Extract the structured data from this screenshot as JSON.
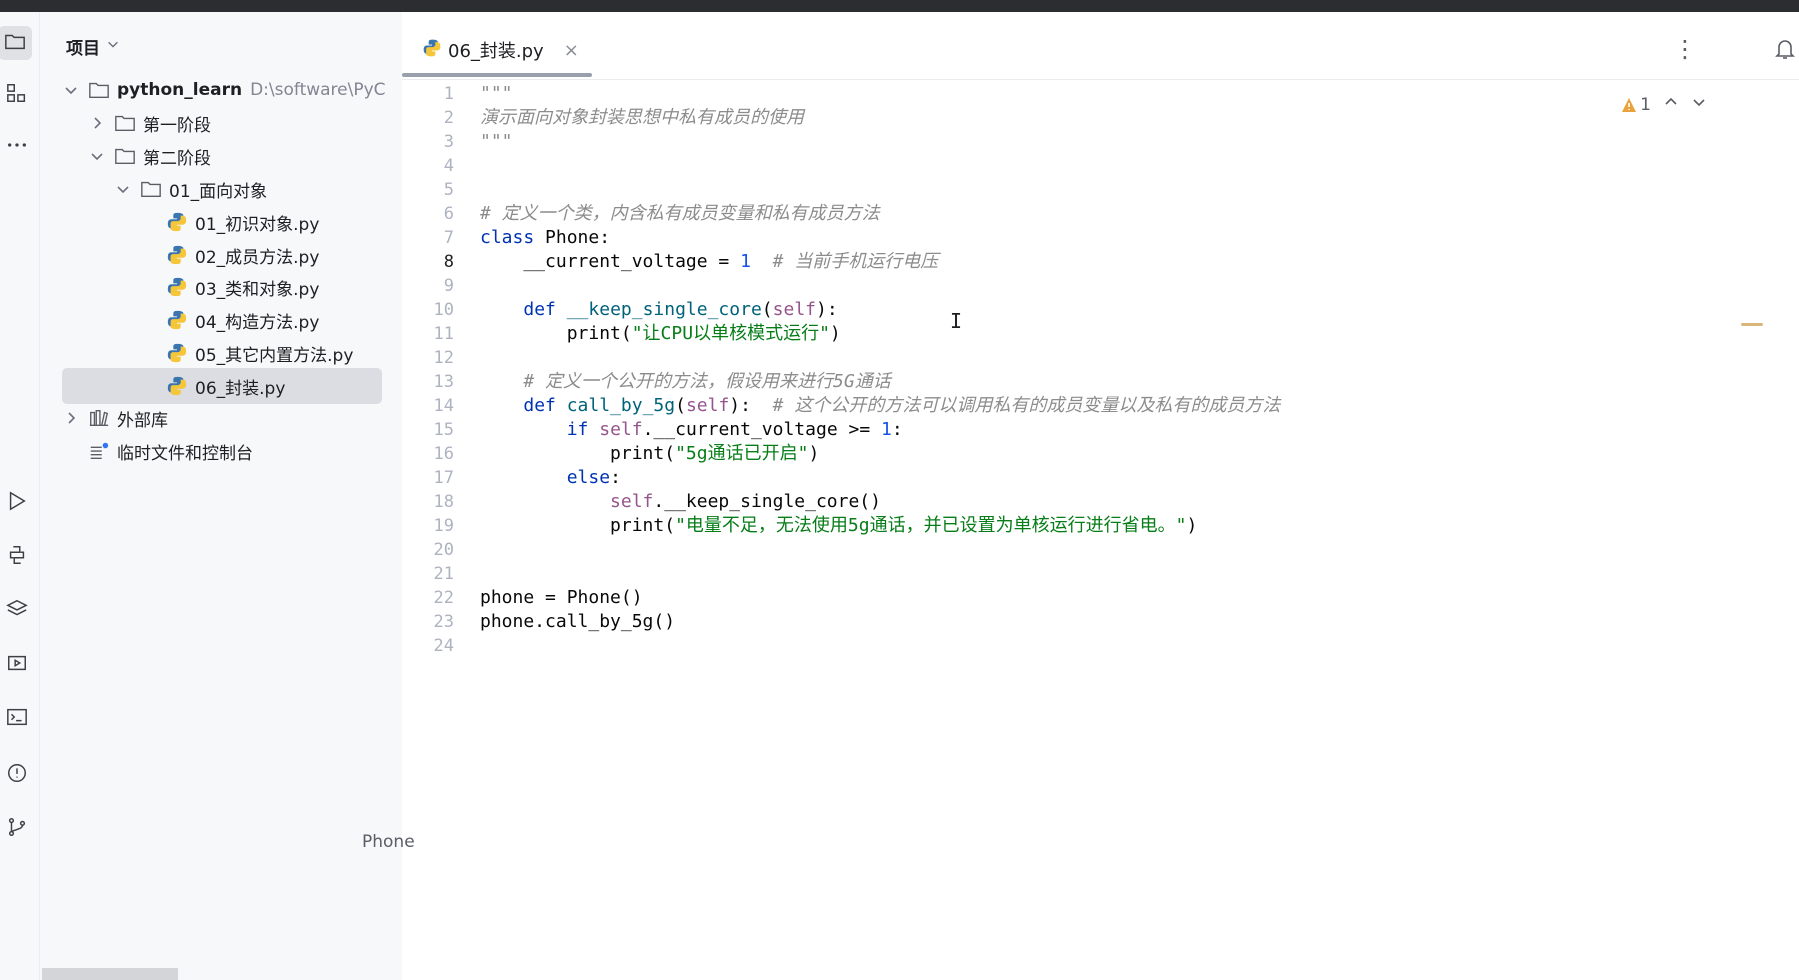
{
  "sidebar": {
    "header": {
      "title": "项目"
    },
    "tree": [
      {
        "label": "python_learn",
        "hint": "D:\\software\\PyC",
        "level": 0,
        "expanded": true,
        "type": "folder"
      },
      {
        "label": "第一阶段",
        "level": 1,
        "expanded": false,
        "type": "folder"
      },
      {
        "label": "第二阶段",
        "level": 1,
        "expanded": true,
        "type": "folder"
      },
      {
        "label": "01_面向对象",
        "level": 2,
        "expanded": true,
        "type": "folder"
      },
      {
        "label": "01_初识对象.py",
        "level": 3,
        "type": "python-file"
      },
      {
        "label": "02_成员方法.py",
        "level": 3,
        "type": "python-file"
      },
      {
        "label": "03_类和对象.py",
        "level": 3,
        "type": "python-file"
      },
      {
        "label": "04_构造方法.py",
        "level": 3,
        "type": "python-file"
      },
      {
        "label": "05_其它内置方法.py",
        "level": 3,
        "type": "python-file"
      },
      {
        "label": "06_封装.py",
        "level": 3,
        "type": "python-file",
        "selected": true
      },
      {
        "label": "外部库",
        "level": 0,
        "expanded": false,
        "type": "library"
      },
      {
        "label": "临时文件和控制台",
        "level": 0,
        "type": "scratches"
      }
    ]
  },
  "editor": {
    "tab": {
      "label": "06_封装.py",
      "close": "×"
    },
    "inspections": {
      "warnings": "1"
    },
    "current_line": 8,
    "breadcrumb": "Phone",
    "lines": [
      {
        "n": "1",
        "tokens": [
          {
            "t": "\"\"\"",
            "c": "doc"
          }
        ]
      },
      {
        "n": "2",
        "tokens": [
          {
            "t": "演示面向对象封装思想中私有成员的使用",
            "c": "doc"
          }
        ]
      },
      {
        "n": "3",
        "tokens": [
          {
            "t": "\"\"\"",
            "c": "doc"
          }
        ]
      },
      {
        "n": "4",
        "tokens": []
      },
      {
        "n": "5",
        "tokens": []
      },
      {
        "n": "6",
        "tokens": [
          {
            "t": "# 定义一个类，内含私有成员变量和私有成员方法",
            "c": "cm"
          }
        ]
      },
      {
        "n": "7",
        "tokens": [
          {
            "t": "class",
            "c": "kw"
          },
          {
            "t": " Phone:",
            "c": ""
          }
        ]
      },
      {
        "n": "8",
        "tokens": [
          {
            "t": "    __current_voltage = ",
            "c": ""
          },
          {
            "t": "1",
            "c": "num"
          },
          {
            "t": "  ",
            "c": ""
          },
          {
            "t": "# 当前手机运行电压",
            "c": "cm"
          }
        ]
      },
      {
        "n": "9",
        "tokens": []
      },
      {
        "n": "10",
        "tokens": [
          {
            "t": "    ",
            "c": ""
          },
          {
            "t": "def",
            "c": "kw"
          },
          {
            "t": " ",
            "c": ""
          },
          {
            "t": "__keep_single_core",
            "c": "fn"
          },
          {
            "t": "(",
            "c": ""
          },
          {
            "t": "self",
            "c": "self"
          },
          {
            "t": "):",
            "c": ""
          }
        ]
      },
      {
        "n": "11",
        "tokens": [
          {
            "t": "        print(",
            "c": ""
          },
          {
            "t": "\"让CPU以单核模式运行\"",
            "c": "str"
          },
          {
            "t": ")",
            "c": ""
          }
        ]
      },
      {
        "n": "12",
        "tokens": []
      },
      {
        "n": "13",
        "tokens": [
          {
            "t": "    ",
            "c": ""
          },
          {
            "t": "# 定义一个公开的方法，假设用来进行5G通话",
            "c": "cm"
          }
        ]
      },
      {
        "n": "14",
        "tokens": [
          {
            "t": "    ",
            "c": ""
          },
          {
            "t": "def",
            "c": "kw"
          },
          {
            "t": " ",
            "c": ""
          },
          {
            "t": "call_by_5g",
            "c": "fn"
          },
          {
            "t": "(",
            "c": ""
          },
          {
            "t": "self",
            "c": "self"
          },
          {
            "t": "):  ",
            "c": ""
          },
          {
            "t": "# 这个公开的方法可以调用私有的成员变量以及私有的成员方法",
            "c": "cm"
          }
        ]
      },
      {
        "n": "15",
        "tokens": [
          {
            "t": "        ",
            "c": ""
          },
          {
            "t": "if",
            "c": "kw"
          },
          {
            "t": " ",
            "c": ""
          },
          {
            "t": "self",
            "c": "self"
          },
          {
            "t": ".__current_voltage >= ",
            "c": ""
          },
          {
            "t": "1",
            "c": "num"
          },
          {
            "t": ":",
            "c": ""
          }
        ]
      },
      {
        "n": "16",
        "tokens": [
          {
            "t": "            print(",
            "c": ""
          },
          {
            "t": "\"5g通话已开启\"",
            "c": "str"
          },
          {
            "t": ")",
            "c": ""
          }
        ]
      },
      {
        "n": "17",
        "tokens": [
          {
            "t": "        ",
            "c": ""
          },
          {
            "t": "else",
            "c": "kw"
          },
          {
            "t": ":",
            "c": ""
          }
        ]
      },
      {
        "n": "18",
        "tokens": [
          {
            "t": "            ",
            "c": ""
          },
          {
            "t": "self",
            "c": "self"
          },
          {
            "t": ".__keep_single_core()",
            "c": ""
          }
        ]
      },
      {
        "n": "19",
        "tokens": [
          {
            "t": "            print(",
            "c": ""
          },
          {
            "t": "\"电量不足，无法使用5g通话，并已设置为单核运行进行省电。\"",
            "c": "str"
          },
          {
            "t": ")",
            "c": ""
          }
        ]
      },
      {
        "n": "20",
        "tokens": []
      },
      {
        "n": "21",
        "tokens": []
      },
      {
        "n": "22",
        "tokens": [
          {
            "t": "phone = Phone()",
            "c": ""
          }
        ]
      },
      {
        "n": "23",
        "tokens": [
          {
            "t": "phone.call_by_5g()",
            "c": ""
          }
        ]
      },
      {
        "n": "24",
        "tokens": []
      }
    ]
  },
  "activity_bar": {
    "icons": [
      "folder-icon",
      "structure-icon",
      "more-icon",
      "run-icon",
      "python-console-icon",
      "layers-icon",
      "services-icon",
      "terminal-icon",
      "problems-icon",
      "git-icon"
    ]
  }
}
